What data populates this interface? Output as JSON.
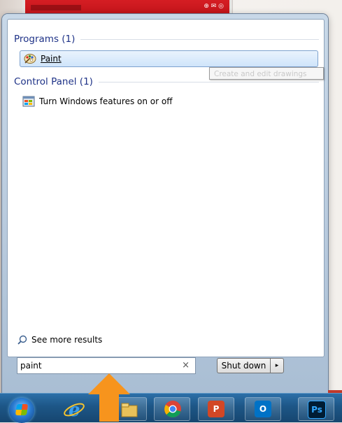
{
  "search_results": {
    "programs_header": "Programs (1)",
    "programs": [
      {
        "label": "Paint",
        "icon": "paint-palette-icon"
      }
    ],
    "control_panel_header": "Control Panel (1)",
    "control_panel": [
      {
        "label": "Turn Windows features on or off",
        "icon": "windows-features-icon"
      }
    ],
    "tooltip": "Create and edit drawings",
    "see_more": "See more results"
  },
  "search": {
    "value": "paint",
    "clear_icon": "close-icon"
  },
  "shutdown": {
    "label": "Shut down",
    "arrow": "▸"
  },
  "taskbar": {
    "items": [
      {
        "name": "start-orb",
        "icon": "windows-logo-icon"
      },
      {
        "name": "internet-explorer",
        "icon": "internet-explorer-icon"
      },
      {
        "name": "file-explorer",
        "icon": "folder-icon"
      },
      {
        "name": "chrome",
        "icon": "chrome-icon"
      },
      {
        "name": "powerpoint",
        "icon": "powerpoint-icon",
        "letter": "P"
      },
      {
        "name": "outlook",
        "icon": "outlook-icon",
        "letter": "O"
      },
      {
        "name": "photoshop",
        "icon": "photoshop-icon",
        "letter": "Ps"
      }
    ]
  },
  "colors": {
    "accent_orange": "#f7941d",
    "header_blue": "#1e3287",
    "taskbar_blue": "#1d5686"
  }
}
